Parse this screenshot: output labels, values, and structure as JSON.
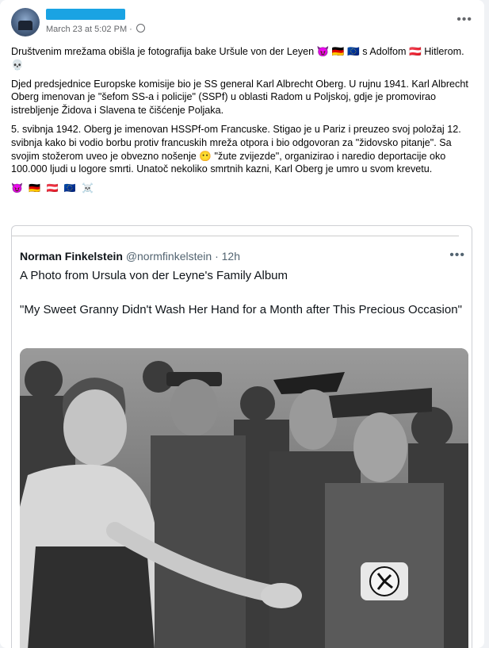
{
  "post": {
    "timestamp": "March 23 at 5:02 PM",
    "privacy_separator": "·",
    "more_glyph": "•••",
    "paragraphs": [
      "Društvenim mrežama obišla je fotografija bake Uršule von der Leyen 😈 🇩🇪 🇪🇺 s Adolfom 🇦🇹 Hitlerom. 💀",
      "Djed predsjednice Europske komisije bio je SS general Karl Albrecht Oberg. U rujnu 1941. Karl Albrecht Oberg imenovan je \"šefom SS-a i policije\" (SSPf) u oblasti Radom u Poljskoj, gdje je promovirao istrebljenje Židova i Slavena te čišćenje Poljaka.",
      "5. svibnja 1942. Oberg je imenovan HSSPf-om Francuske. Stigao je u Pariz i preuzeo svoj položaj 12. svibnja kako bi vodio borbu protiv francuskih mreža otpora i bio odgovoran za \"židovsko pitanje\". Sa svojim stožerom uveo je obvezno nošenje 😶 \"žute zvijezde\", organizirao i naredio deportacije oko 100.000 ljudi u logore smrti. Unatoč nekoliko smrtnih kazni, Karl Oberg je umro u svom krevetu."
    ],
    "emoji_row": "😈 🇩🇪 🇦🇹 🇪🇺 ☠️"
  },
  "tweet": {
    "name": "Norman Finkelstein",
    "handle": "@normfinkelstein",
    "separator": "·",
    "age": "12h",
    "more_glyph": "•••",
    "line1": "A Photo from Ursula von der Leyne's Family Album",
    "quote": "\"My Sweet Granny Didn't Wash Her Hand for a Month after This Precious Occasion\""
  },
  "colors": {
    "redaction": "#1aa3e3",
    "meta_text": "#65676b",
    "body_text": "#050505",
    "tweet_handle": "#536471"
  }
}
